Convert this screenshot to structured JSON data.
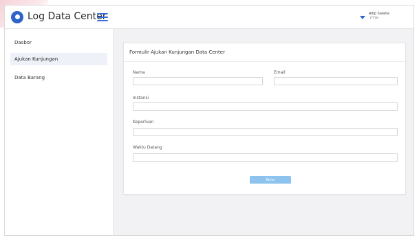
{
  "app": {
    "brand": "Log Data Center"
  },
  "user": {
    "name": "Adip Salatia",
    "role": "FTTH"
  },
  "sidebar": {
    "items": [
      {
        "label": "Dasbor",
        "active": false
      },
      {
        "label": "Ajukan Kunjungan",
        "active": true
      },
      {
        "label": "Data Barang",
        "active": false
      }
    ]
  },
  "form": {
    "title": "Formulir Ajukan Kunjungan Data Center",
    "fields": {
      "nama": {
        "label": "Nama",
        "value": ""
      },
      "email": {
        "label": "Email",
        "value": ""
      },
      "instansi": {
        "label": "Instansi",
        "value": ""
      },
      "keperluan": {
        "label": "Keperluan",
        "value": ""
      },
      "waktu_datang": {
        "label": "Waktu Datang",
        "value": ""
      }
    },
    "submit_label": "Kirim"
  },
  "colors": {
    "brand_blue": "#2e63c9",
    "submit_button": "#8cc4ef",
    "background": "#f2f2f4"
  },
  "icons": {
    "logo": "logo-icon",
    "menu": "hamburger-menu-icon",
    "dropdown": "caret-down-icon"
  }
}
